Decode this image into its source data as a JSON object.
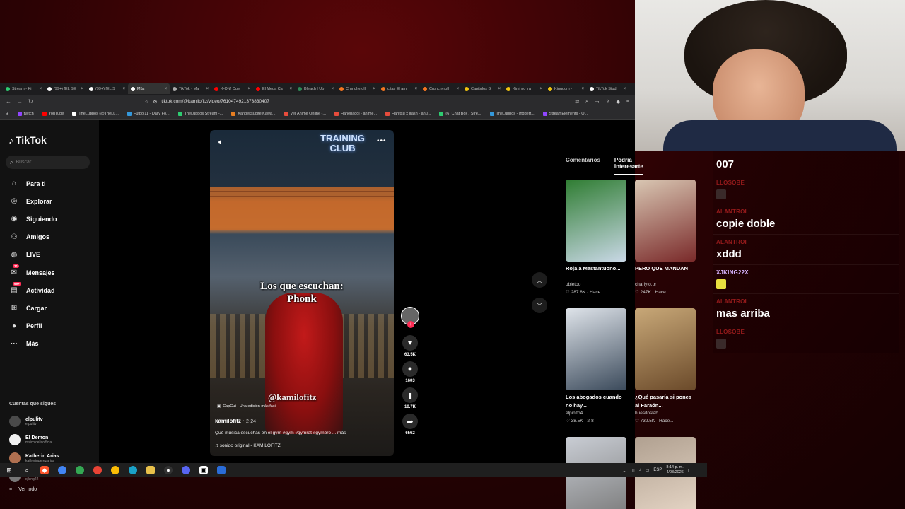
{
  "browser": {
    "tabs": [
      {
        "label": "Stream - Ki",
        "color": "#2ecc71"
      },
      {
        "label": "(99+) [EL SE",
        "color": "#ffffff"
      },
      {
        "label": "(99+) [EL S",
        "color": "#ffffff"
      },
      {
        "label": "Mús",
        "color": "#ffffff",
        "active": true
      },
      {
        "label": "TikTok - Ma",
        "color": "#aaaaaa"
      },
      {
        "label": "K-ON! Ope",
        "color": "#ff0000"
      },
      {
        "label": "El Mega Ca",
        "color": "#ff0000"
      },
      {
        "label": "Bleach | Ub",
        "color": "#2e8b57"
      },
      {
        "label": "Crunchyroll",
        "color": "#f47521"
      },
      {
        "label": "citas El ami",
        "color": "#f47521"
      },
      {
        "label": "Crunchyroll",
        "color": "#f47521"
      },
      {
        "label": "Capitulos B",
        "color": "#f1c40f"
      },
      {
        "label": "Kimi no ira",
        "color": "#f1c40f"
      },
      {
        "label": "Kingdom -",
        "color": "#f1c40f"
      },
      {
        "label": "TikTok Stud",
        "color": "#ffffff"
      }
    ],
    "url": "tiktok.com/@kamilofitz/video/7610474921373830407",
    "bookmarks": [
      {
        "label": "twitch",
        "color": "#9146ff"
      },
      {
        "label": "YouTube",
        "color": "#ff0000"
      },
      {
        "label": "TheLuppos (@TheLu...",
        "color": "#ffffff"
      },
      {
        "label": "Futbol11 - Daily Fo...",
        "color": "#3498db"
      },
      {
        "label": "TheLuppos Stream -...",
        "color": "#2ecc71"
      },
      {
        "label": "Kanpeksugite Kawa...",
        "color": "#e67e22"
      },
      {
        "label": "Ver Anime Online -...",
        "color": "#e74c3c"
      },
      {
        "label": "Hanebadol - anime...",
        "color": "#e74c3c"
      },
      {
        "label": "Hanitsu x Irash - anu...",
        "color": "#e74c3c"
      },
      {
        "label": "(6) Chat Box / Stre...",
        "color": "#2ecc71"
      },
      {
        "label": "TheLuppos - Inggerf...",
        "color": "#3498db"
      },
      {
        "label": "StreamElements - O...",
        "color": "#9146ff"
      }
    ]
  },
  "tiktok": {
    "logo": "TikTok",
    "search_placeholder": "Buscar",
    "menu": [
      {
        "label": "Para ti",
        "icon": "home-icon",
        "glyph": "⌂"
      },
      {
        "label": "Explorar",
        "icon": "compass-icon",
        "glyph": "◎"
      },
      {
        "label": "Siguiendo",
        "icon": "following-icon",
        "glyph": "◉"
      },
      {
        "label": "Amigos",
        "icon": "friends-icon",
        "glyph": "⚇"
      },
      {
        "label": "LIVE",
        "icon": "live-icon",
        "glyph": "◍"
      },
      {
        "label": "Mensajes",
        "icon": "messages-icon",
        "glyph": "✉",
        "badge": "31"
      },
      {
        "label": "Actividad",
        "icon": "activity-icon",
        "glyph": "▤",
        "badge": "99+"
      },
      {
        "label": "Cargar",
        "icon": "upload-icon",
        "glyph": "⊞"
      },
      {
        "label": "Perfil",
        "icon": "profile-icon",
        "glyph": "●"
      },
      {
        "label": "Más",
        "icon": "more-icon",
        "glyph": "···"
      }
    ],
    "following_header": "Cuentas que sigues",
    "accounts": [
      {
        "name": "elpulitv",
        "handle": "elpulitv",
        "color": "#4a4a4a"
      },
      {
        "name": "El Demon",
        "handle": "msicolcelisofficial",
        "color": "#f1f1f1"
      },
      {
        "name": "Katherin Arias",
        "handle": "katherinperezarias",
        "color": "#b07050"
      },
      {
        "name": "XJking22",
        "handle": "xjking22",
        "color": "#777777"
      }
    ],
    "see_all": "Ver todo"
  },
  "video": {
    "overlay_text": "Los que escuchan:\nPhonk",
    "sign": "TRAINING\nCLUB",
    "watermark": "@kamilofitz",
    "capcut": "CapCut · Una edición más fácil",
    "author": "kamilofitz",
    "date": "2-24",
    "description": "Qué música escuchas en el gym #gym #gymrat #gymbro ...  más",
    "sound": "sonido original - KAMILOFITZ",
    "likes": "63.5K",
    "comments": "1603",
    "saves": "10.7K",
    "shares": "6562"
  },
  "suggestions": {
    "tab_comments": "Comentarios",
    "tab_interest": "Podría interesarte",
    "cards": [
      {
        "title": "Roja a Mastantuono...",
        "user": "ubietoo",
        "stats": "♡ 287.8K · Hace...",
        "c1": "#2f7d32",
        "c2": "#c9d8e6"
      },
      {
        "title": "PERO QUE MANDAN",
        "user": "charlyto.pr",
        "stats": "♡ 247K · Hace...",
        "c1": "#d9c7b3",
        "c2": "#7a2a2a"
      },
      {
        "title": "Los abogados cuando no hay...",
        "user": "elpinito4",
        "stats": "♡ 38.5K · 2-8",
        "c1": "#dfe4ea",
        "c2": "#3b4a5b"
      },
      {
        "title": "¿Qué pasaría si pones al Faraón...",
        "user": "huesitoslab",
        "stats": "♡ 732.5K · Hace...",
        "c1": "#c8a878",
        "c2": "#6b4a2a"
      },
      {
        "title": "",
        "user": "",
        "stats": "",
        "c1": "#c9cdd4",
        "c2": "#7a7a7a"
      },
      {
        "title": "",
        "user": "",
        "stats": "",
        "c1": "#b0a090",
        "c2": "#e8d8c8"
      }
    ]
  },
  "chat": [
    {
      "user": "",
      "msg": "007",
      "type": "text"
    },
    {
      "user": "LLOSOBE",
      "msg": "",
      "type": "emote"
    },
    {
      "user": "ALANTROI",
      "msg": "copie doble",
      "type": "text"
    },
    {
      "user": "ALANTROI",
      "msg": "xddd",
      "type": "text"
    },
    {
      "user": "XJKING22X",
      "msg": "",
      "type": "emote-yellow",
      "bright": true
    },
    {
      "user": "ALANTROI",
      "msg": "mas arriba",
      "type": "text"
    },
    {
      "user": "LLOSOBE",
      "msg": "",
      "type": "emote"
    }
  ],
  "taskbar": {
    "language": "ESP",
    "time": "8:14 p. m.",
    "date": "4/03/2026"
  }
}
